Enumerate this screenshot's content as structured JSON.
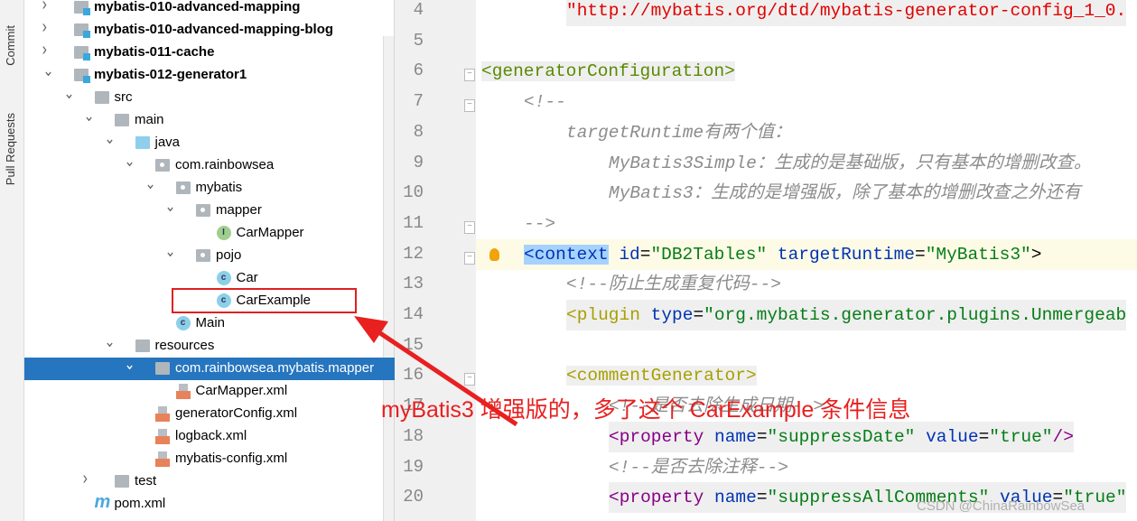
{
  "side_tabs": [
    "Commit",
    "Pull Requests"
  ],
  "tree": [
    {
      "label": "mybatis-010-advanced-mapping",
      "level": 0,
      "icon": "module",
      "chev": ">",
      "bold": true
    },
    {
      "label": "mybatis-010-advanced-mapping-blog",
      "level": 0,
      "icon": "module",
      "chev": ">",
      "bold": true
    },
    {
      "label": "mybatis-011-cache",
      "level": 0,
      "icon": "module",
      "chev": ">",
      "bold": true
    },
    {
      "label": "mybatis-012-generator1",
      "level": 0,
      "icon": "module",
      "chev": "v",
      "bold": true
    },
    {
      "label": "src",
      "level": 1,
      "icon": "folder",
      "chev": "v"
    },
    {
      "label": "main",
      "level": 2,
      "icon": "folder",
      "chev": "v"
    },
    {
      "label": "java",
      "level": 3,
      "icon": "java",
      "chev": "v"
    },
    {
      "label": "com.rainbowsea",
      "level": 4,
      "icon": "package",
      "chev": "v"
    },
    {
      "label": "mybatis",
      "level": 5,
      "icon": "package",
      "chev": "v"
    },
    {
      "label": "mapper",
      "level": 6,
      "icon": "package",
      "chev": "v"
    },
    {
      "label": "CarMapper",
      "level": 7,
      "icon": "interface"
    },
    {
      "label": "pojo",
      "level": 6,
      "icon": "package",
      "chev": "v"
    },
    {
      "label": "Car",
      "level": 7,
      "icon": "class"
    },
    {
      "label": "CarExample",
      "level": 7,
      "icon": "class"
    },
    {
      "label": "Main",
      "level": 5,
      "icon": "class"
    },
    {
      "label": "resources",
      "level": 3,
      "icon": "folder",
      "chev": "v"
    },
    {
      "label": "com.rainbowsea.mybatis.mapper",
      "level": 4,
      "icon": "folder",
      "chev": "v",
      "selected": true
    },
    {
      "label": "CarMapper.xml",
      "level": 5,
      "icon": "xml"
    },
    {
      "label": "generatorConfig.xml",
      "level": 4,
      "icon": "xml"
    },
    {
      "label": "logback.xml",
      "level": 4,
      "icon": "xml"
    },
    {
      "label": "mybatis-config.xml",
      "level": 4,
      "icon": "xml"
    },
    {
      "label": "test",
      "level": 2,
      "icon": "folder",
      "chev": ">"
    },
    {
      "label": "pom.xml",
      "level": 1,
      "icon": "maven"
    }
  ],
  "code": [
    {
      "n": "4",
      "indent": 2,
      "tokens": [
        [
          "str",
          "\"http://mybatis.org/dtd/mybatis-generator-config_1_0."
        ]
      ]
    },
    {
      "n": "5",
      "indent": 0,
      "tokens": []
    },
    {
      "n": "6",
      "indent": 0,
      "fold": true,
      "tokens": [
        [
          "tag",
          "<generatorConfiguration>"
        ]
      ]
    },
    {
      "n": "7",
      "indent": 1,
      "fold": true,
      "tokens": [
        [
          "cm",
          "<!--"
        ]
      ]
    },
    {
      "n": "8",
      "indent": 2,
      "tokens": [
        [
          "cm",
          "targetRuntime有两个值："
        ]
      ]
    },
    {
      "n": "9",
      "indent": 3,
      "tokens": [
        [
          "cm",
          "MyBatis3Simple：生成的是基础版，只有基本的增删改查。"
        ]
      ]
    },
    {
      "n": "10",
      "indent": 3,
      "tokens": [
        [
          "cm",
          "MyBatis3：生成的是增强版，除了基本的增删改查之外还有"
        ]
      ]
    },
    {
      "n": "11",
      "indent": 1,
      "fold": true,
      "tokens": [
        [
          "cm",
          "-->"
        ]
      ]
    },
    {
      "n": "12",
      "indent": 1,
      "fold": true,
      "current": true,
      "bulb": true,
      "tokens": [
        [
          "sel",
          "<context"
        ],
        [
          "plain",
          " "
        ],
        [
          "attr",
          "id"
        ],
        [
          "plain",
          "="
        ],
        [
          "val",
          "\"DB2Tables\""
        ],
        [
          "plain",
          " "
        ],
        [
          "attr",
          "targetRuntime"
        ],
        [
          "plain",
          "="
        ],
        [
          "val",
          "\"MyBatis3\""
        ],
        [
          "plain",
          ">"
        ]
      ]
    },
    {
      "n": "13",
      "indent": 2,
      "tokens": [
        [
          "cm",
          "<!--防止生成重复代码-->"
        ]
      ]
    },
    {
      "n": "14",
      "indent": 2,
      "bg": true,
      "tokens": [
        [
          "tag2",
          "<plugin"
        ],
        [
          "plain",
          " "
        ],
        [
          "attr",
          "type"
        ],
        [
          "plain",
          "="
        ],
        [
          "val",
          "\"org.mybatis.generator.plugins.Unmergeab"
        ]
      ]
    },
    {
      "n": "15",
      "indent": 0,
      "tokens": []
    },
    {
      "n": "16",
      "indent": 2,
      "fold": true,
      "tokens": [
        [
          "tag2",
          "<commentGenerator>"
        ]
      ]
    },
    {
      "n": "17",
      "indent": 3,
      "tokens": [
        [
          "cm",
          "<!--是否去除生成日期-->"
        ]
      ]
    },
    {
      "n": "18",
      "indent": 3,
      "bg": true,
      "tokens": [
        [
          "ptag",
          "<property"
        ],
        [
          "plain",
          " "
        ],
        [
          "attr",
          "name"
        ],
        [
          "plain",
          "="
        ],
        [
          "val",
          "\"suppressDate\""
        ],
        [
          "plain",
          " "
        ],
        [
          "attr",
          "value"
        ],
        [
          "plain",
          "="
        ],
        [
          "val",
          "\"true\""
        ],
        [
          "ptag",
          "/>"
        ]
      ]
    },
    {
      "n": "19",
      "indent": 3,
      "tokens": [
        [
          "cm",
          "<!--是否去除注释-->"
        ]
      ]
    },
    {
      "n": "20",
      "indent": 3,
      "bg": true,
      "tokens": [
        [
          "ptag",
          "<property"
        ],
        [
          "plain",
          " "
        ],
        [
          "attr",
          "name"
        ],
        [
          "plain",
          "="
        ],
        [
          "val",
          "\"suppressAllComments\""
        ],
        [
          "plain",
          " "
        ],
        [
          "attr",
          "value"
        ],
        [
          "plain",
          "="
        ],
        [
          "val",
          "\"true\""
        ]
      ]
    }
  ],
  "annotation": "myBatis3 增强版的，多了这个 CarExample 条件信息",
  "watermark": "CSDN @ChinaRainbowSea",
  "colors": {
    "annotation": "#e82020",
    "selection": "#2675bf"
  }
}
